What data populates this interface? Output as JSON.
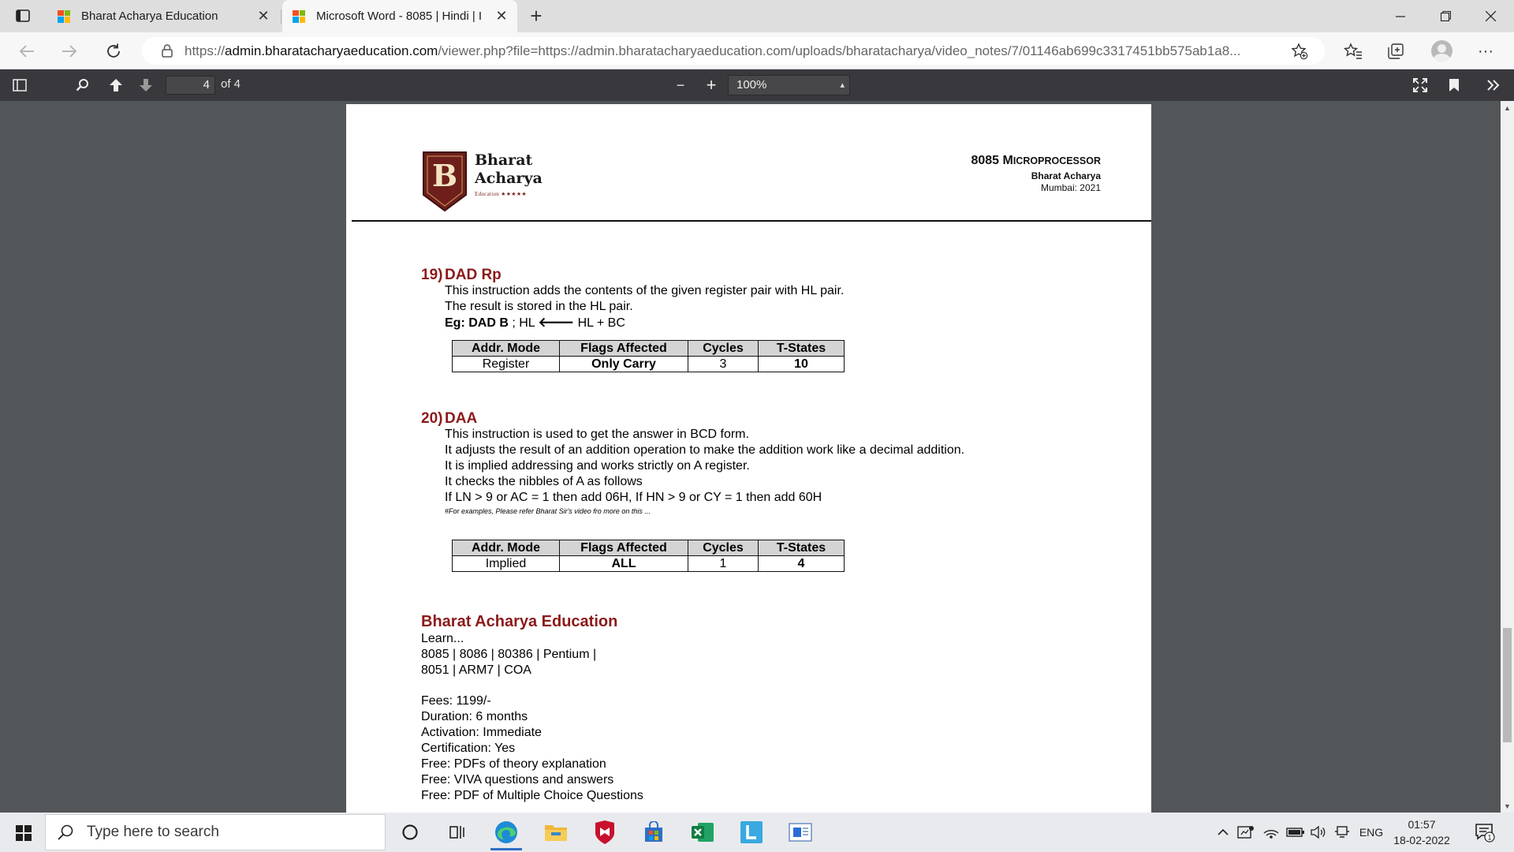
{
  "browser": {
    "tabs": [
      {
        "title": "Bharat Acharya Education",
        "active": false
      },
      {
        "title": "Microsoft Word - 8085 | Hindi | I",
        "active": true
      }
    ],
    "url_domain": "admin.bharatacharyaeducation.com",
    "url_scheme": "https://",
    "url_rest": "/viewer.php?file=https://admin.bharatacharyaeducation.com/uploads/bharatacharya/video_notes/7/01146ab699c3317451bb575ab1a8..."
  },
  "pdf_toolbar": {
    "page_number": "4",
    "page_of": "of 4",
    "zoom_value": "100%",
    "zoom_out_label": "−",
    "zoom_in_label": "+"
  },
  "document": {
    "logo_name_line1": "Bharat",
    "logo_name_line2": "Acharya",
    "logo_sub": "Education ★★★★★",
    "logo_letter": "B",
    "header_title_prefix": "8085 M",
    "header_title_sc": "ICROPROCESSOR",
    "header_author": "Bharat Acharya",
    "header_place": "Mumbai: 2021",
    "sections": [
      {
        "number": "19)",
        "title": "DAD Rp",
        "lines": [
          "This instruction adds the contents of the given register pair with HL pair.",
          "The result is stored in the HL pair."
        ],
        "example_label": "Eg: DAD B",
        "example_pre": " ; HL ",
        "example_post": " HL + BC",
        "table_headers": [
          "Addr. Mode",
          "Flags Affected",
          "Cycles",
          "T-States"
        ],
        "table_row": [
          "Register",
          "Only Carry",
          "3",
          "10"
        ]
      },
      {
        "number": "20)",
        "title": "DAA",
        "lines": [
          "This instruction is used to get the answer in BCD form.",
          "It adjusts the result of an addition operation to make the addition work like a decimal addition.",
          "It is implied addressing and works strictly on A register.",
          "It checks the nibbles of A as follows",
          "If LN > 9 or AC = 1 then add 06H, If HN > 9 or CY = 1 then add 60H"
        ],
        "note": "#For examples, Please refer Bharat Sir's video fro more on this ...",
        "table_headers": [
          "Addr. Mode",
          "Flags Affected",
          "Cycles",
          "T-States"
        ],
        "table_row": [
          "Implied",
          "ALL",
          "1",
          "4"
        ]
      }
    ],
    "promo": {
      "title": "Bharat Acharya Education",
      "lines": [
        "Learn...",
        "8085 | 8086 | 80386 | Pentium |",
        "8051 | ARM7 | COA",
        "",
        "Fees: 1199/-",
        "Duration: 6 months",
        "Activation: Immediate",
        "Certification: Yes",
        "Free: PDFs of theory explanation",
        "Free: VIVA questions and answers",
        "Free: PDF of Multiple Choice Questions"
      ]
    }
  },
  "taskbar": {
    "search_placeholder": "Type here to search",
    "language": "ENG",
    "time": "01:57",
    "date": "18-02-2022",
    "notification_count": "1"
  },
  "colors": {
    "accent_red": "#8b1a1a",
    "pdf_toolbar": "#38383d",
    "viewer_bg": "#525659"
  }
}
